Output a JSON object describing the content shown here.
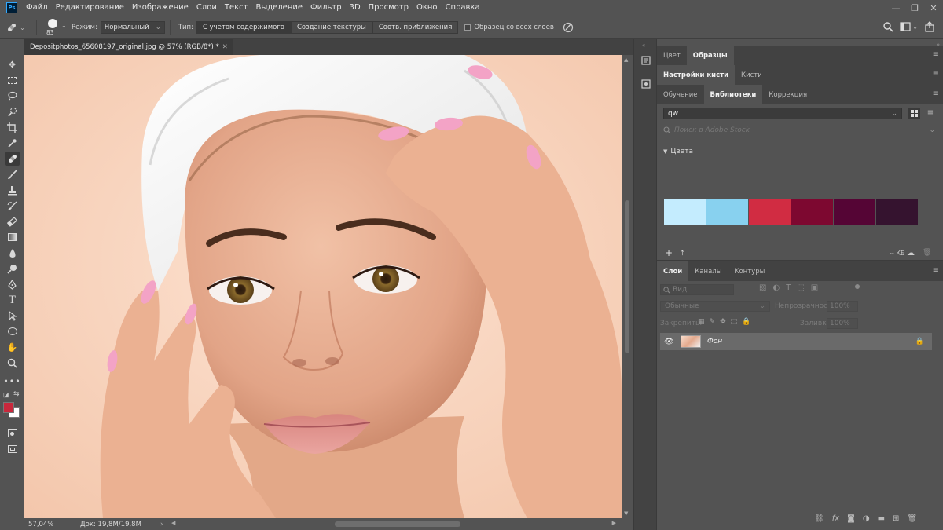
{
  "menu": {
    "logo": "Ps",
    "items": [
      "Файл",
      "Редактирование",
      "Изображение",
      "Слои",
      "Текст",
      "Выделение",
      "Фильтр",
      "3D",
      "Просмотр",
      "Окно",
      "Справка"
    ]
  },
  "window_controls": {
    "minimize": "—",
    "restore": "❐",
    "close": "✕"
  },
  "options": {
    "brush_size": "83",
    "mode_label": "Режим:",
    "mode_value": "Нормальный",
    "type_label": "Тип:",
    "type_options": [
      "С учетом содержимого",
      "Создание текстуры",
      "Соотв. приближения"
    ],
    "sample_all_layers": "Образец со всех слоев"
  },
  "document": {
    "tab_title": "Depositphotos_65608197_original.jpg @ 57% (RGB/8*) *",
    "zoom": "57,04%",
    "doc_info": "Док: 19,8M/19,8M"
  },
  "colors": {
    "foreground": "#c8283c",
    "background": "#ffffff",
    "accent": "#31a8ff"
  },
  "panels": {
    "top_tabs": [
      "Цвет",
      "Образцы"
    ],
    "brush_tabs": [
      "Настройки кисти",
      "Кисти"
    ],
    "library_tabs": [
      "Обучение",
      "Библиотеки",
      "Коррекция"
    ],
    "library_name": "qw",
    "search_placeholder": "Поиск в Adobe Stock",
    "colors_group": "Цвета",
    "swatches": [
      "#c4ecfe",
      "#88d1ef",
      "#d12c42",
      "#7d0830",
      "#550535",
      "#35132f"
    ],
    "kb_label": "-- КБ",
    "layers_tabs": [
      "Слои",
      "Каналы",
      "Контуры"
    ],
    "filter_placeholder": "Вид",
    "blend_mode": "Обычные",
    "opacity_label": "Непрозрачность:",
    "opacity_value": "100%",
    "lock_label": "Закрепить:",
    "fill_label": "Заливка:",
    "fill_value": "100%",
    "layer_name": "Фон"
  }
}
